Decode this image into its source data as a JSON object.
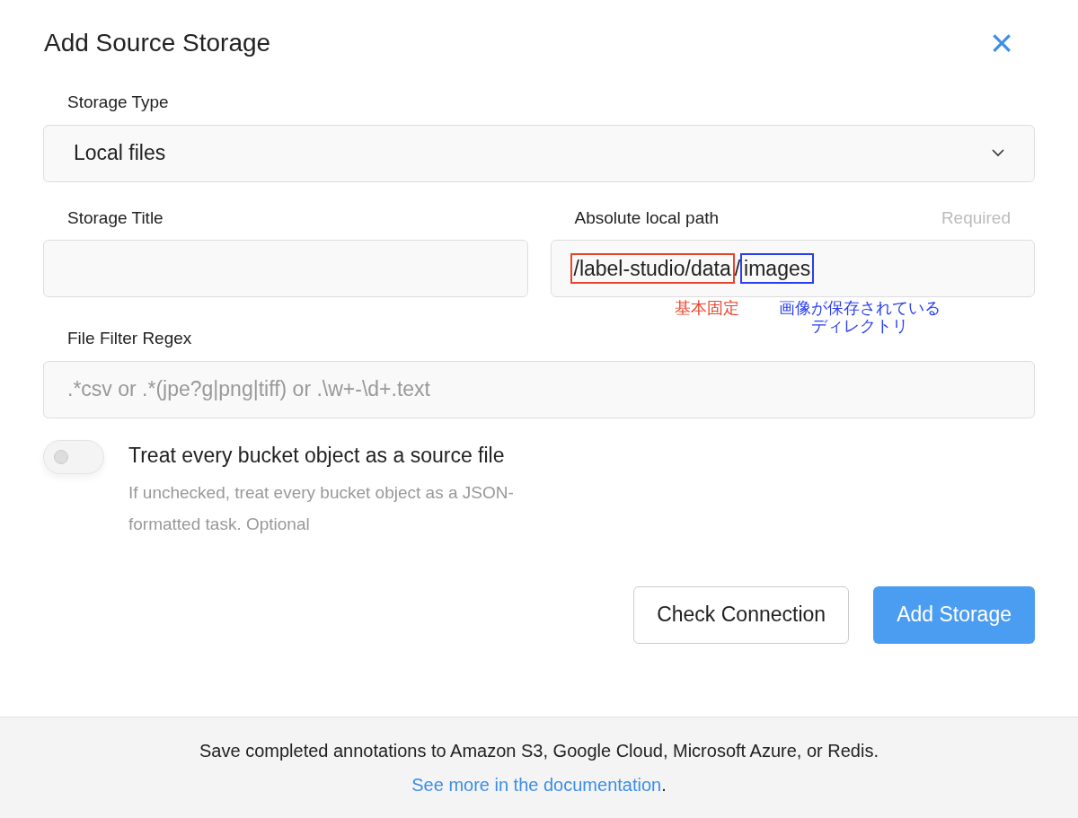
{
  "dialog": {
    "title": "Add Source Storage",
    "close": "×"
  },
  "storage_type": {
    "label": "Storage Type",
    "value": "Local files"
  },
  "storage_title": {
    "label": "Storage Title"
  },
  "local_path": {
    "label": "Absolute local path",
    "required": "Required",
    "segments": [
      {
        "text": "/label-studio/data",
        "color": "#e8452c",
        "note": "基本固定"
      },
      {
        "text": "/"
      },
      {
        "text": "images",
        "color": "#2a3ff0",
        "note": "画像が保存されているディレクトリ"
      }
    ]
  },
  "file_filter": {
    "label": "File Filter Regex",
    "placeholder": ".*csv or .*(jpe?g|png|tiff) or .\\w+-\\d+.text"
  },
  "toggle": {
    "label": "Treat every bucket object as a source file",
    "on": false,
    "hint": "If unchecked, treat every bucket object as a JSON-formatted task. Optional"
  },
  "buttons": [
    {
      "label": "Check Connection",
      "kind": "secondary"
    },
    {
      "label": "Add Storage",
      "kind": "primary"
    }
  ],
  "footer": {
    "text": "Save completed annotations to Amazon S3, Google Cloud, Microsoft Azure, or Redis.",
    "link": "See more in the documentation",
    "after": "."
  }
}
